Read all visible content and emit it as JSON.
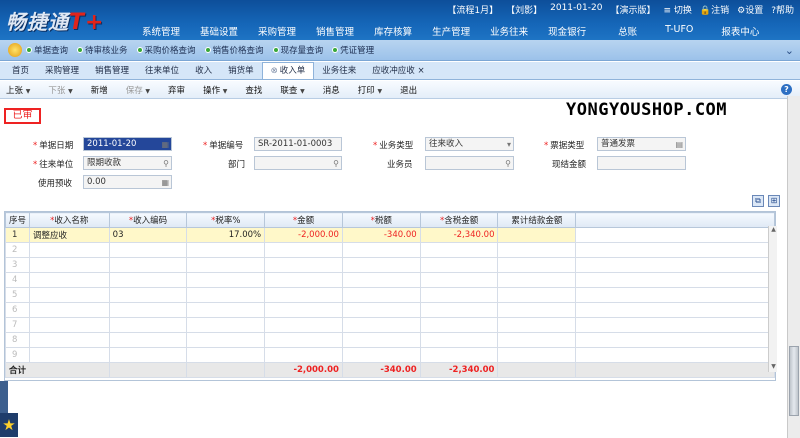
{
  "app": {
    "logo_text": "畅捷通",
    "logo_mark": "T+",
    "status": {
      "process": "【流程1月】",
      "user": "【刘影】",
      "date": "2011-01-20",
      "account": "【演示版】",
      "switch": "切换",
      "logout": "注销",
      "settings": "设置",
      "help": "帮助"
    },
    "nav": [
      "系统管理",
      "基础设置",
      "采购管理",
      "销售管理",
      "库存核算",
      "生产管理",
      "业务往来",
      "现金银行",
      "总账",
      "T-UFO",
      "报表中心"
    ]
  },
  "quicklinks": [
    "单据查询",
    "待审核业务",
    "采购价格查询",
    "销售价格查询",
    "现存量查询",
    "凭证管理"
  ],
  "tabs": [
    {
      "label": "首页",
      "active": false
    },
    {
      "label": "采购管理",
      "active": false
    },
    {
      "label": "销售管理",
      "active": false
    },
    {
      "label": "往来单位",
      "active": false
    },
    {
      "label": "收入",
      "active": false
    },
    {
      "label": "销货单",
      "active": false
    },
    {
      "label": "收入单",
      "active": true
    },
    {
      "label": "业务往来",
      "active": false
    },
    {
      "label": "应收冲应收",
      "active": false
    }
  ],
  "toolbar": {
    "prev": "上张",
    "next": "下张",
    "new": "新增",
    "save": "保存",
    "unaudit": "弃审",
    "operate": "操作",
    "find": "查找",
    "link": "联查",
    "message": "消息",
    "print": "打印",
    "exit": "退出"
  },
  "audit_stamp": "已审",
  "watermark": "YONGYOUSHOP.COM",
  "form": {
    "doc_date_label": "单据日期",
    "doc_date": "2011-01-20",
    "doc_no_label": "单据编号",
    "doc_no": "SR-2011-01-0003",
    "biz_type_label": "业务类型",
    "biz_type": "往来收入",
    "invoice_type_label": "票据类型",
    "invoice_type": "普通发票",
    "partner_label": "往来单位",
    "partner": "限期收款",
    "dept_label": "部门",
    "dept": "",
    "clerk_label": "业务员",
    "clerk": "",
    "cash_amount_label": "现结金额",
    "cash_amount": "",
    "prepay_label": "使用预收",
    "prepay": "0.00"
  },
  "grid": {
    "headers": [
      "序号",
      "收入名称",
      "收入编码",
      "税率%",
      "金额",
      "税额",
      "含税金额",
      "累计结款金额"
    ],
    "row": {
      "no": "1",
      "name": "调整应收",
      "code": "03",
      "rate": "17.00%",
      "amount": "-2,000.00",
      "tax": "-340.00",
      "total": "-2,340.00",
      "settled": ""
    },
    "empty_rows": [
      "2",
      "3",
      "4",
      "5",
      "6",
      "7",
      "8",
      "9"
    ],
    "total_label": "合计",
    "totals": {
      "amount": "-2,000.00",
      "tax": "-340.00",
      "total": "-2,340.00"
    }
  }
}
